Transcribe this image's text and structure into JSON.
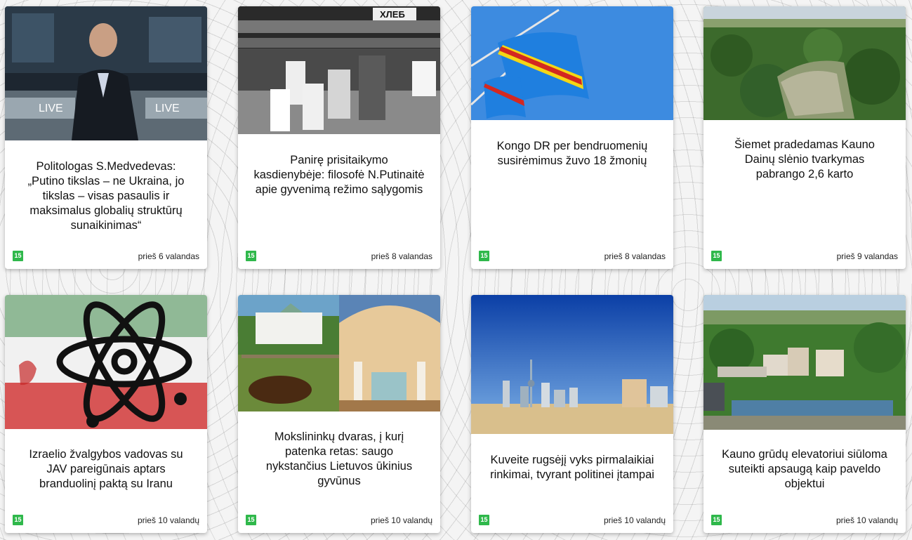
{
  "source_logo": "15",
  "cards": [
    {
      "title": "Politologas S.Medvedevas: „Putino tikslas – ne Ukraina, jo tikslas – visas pasaulis ir maksimalus globalių struktūrų sunaikinimas“",
      "time": "prieš 6 valandas",
      "image_text": [
        "LIVE",
        "LIVE"
      ]
    },
    {
      "title": "Panirę prisitaikymo kasdienybėje: filosofė N.Putinaitė apie gyvenimą režimo sąlygomis",
      "time": "prieš 8 valandas",
      "image_text": [
        "ХЛЕБ"
      ]
    },
    {
      "title": "Kongo DR per bendruomenių susirėmimus žuvo 18 žmonių",
      "time": "prieš 8 valandas"
    },
    {
      "title": "Šiemet pradedamas Kauno Dainų slėnio tvarkymas pabrango 2,6 karto",
      "time": "prieš 9 valandas"
    },
    {
      "title": "Izraelio žvalgybos vadovas su JAV pareigūnais aptars branduolinį paktą su Iranu",
      "time": "prieš 10 valandų"
    },
    {
      "title": "Mokslininkų dvaras, į kurį patenka retas: saugo nykstančius Lietuvos ūkinius gyvūnus",
      "time": "prieš 10 valandų"
    },
    {
      "title": "Kuveite rugsėjį vyks pirmalaikiai rinkimai, tvyrant politinei įtampai",
      "time": "prieš 10 valandų"
    },
    {
      "title": "Kauno grūdų elevatoriui siūloma suteikti apsaugą kaip paveldo objektui",
      "time": "prieš 10 valandų"
    }
  ]
}
